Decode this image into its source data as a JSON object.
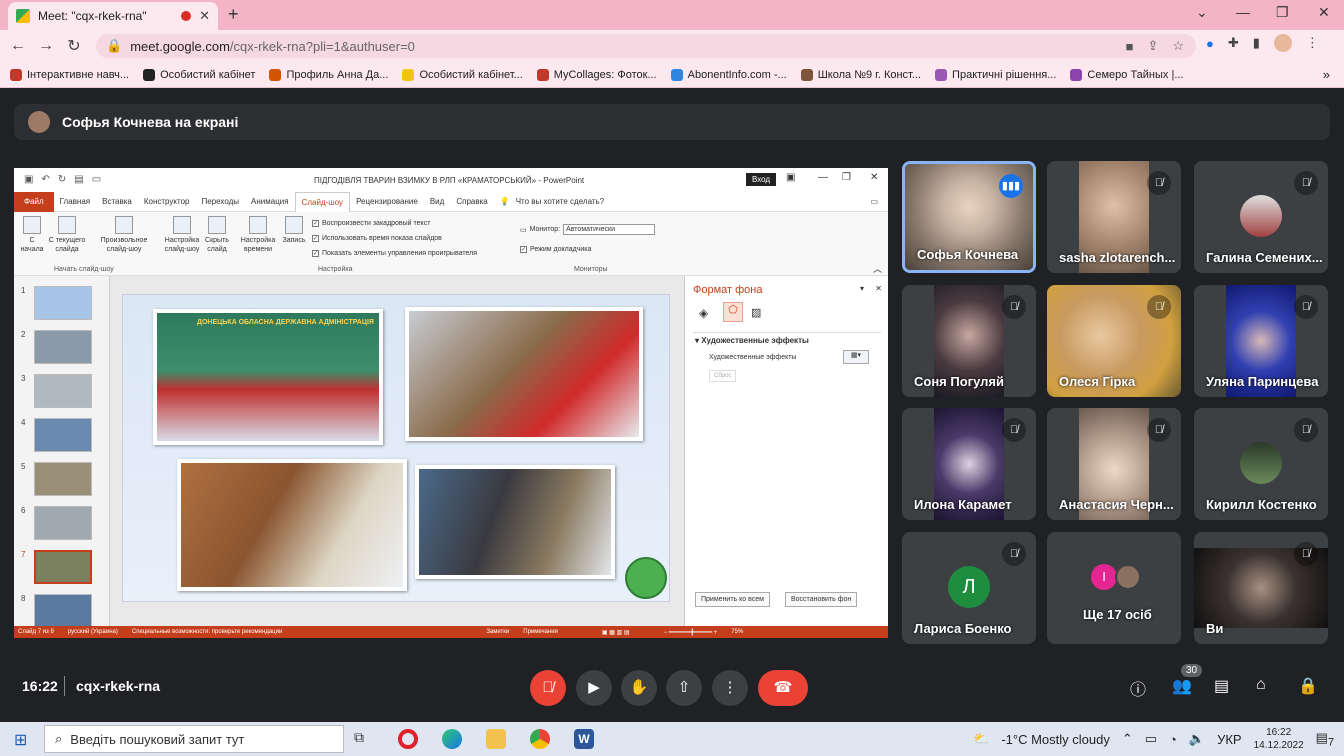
{
  "browser": {
    "tab_title": "Meet: \"cqx-rkek-rna\"",
    "url_domain": "meet.google.com",
    "url_path": "/cqx-rkek-rna?pli=1&authuser=0",
    "bookmarks": [
      "Інтерактивне навч...",
      "Особистий кабінет",
      "Профиль Анна Да...",
      "Особистий кабінет...",
      "MyCollages: Фоток...",
      "AbonentInfo.com -...",
      "Школа №9 г. Конст...",
      "Практичні рішення...",
      "Семеро Тайных |..."
    ],
    "bookmark_colors": [
      "#c0392b",
      "#222222",
      "#d35400",
      "#f1c40f",
      "#c0392b",
      "#2e86de",
      "#7f5539",
      "#9b59b6",
      "#8e44ad"
    ]
  },
  "presenter": {
    "label": "Софья Кочнева на екрані"
  },
  "powerpoint": {
    "title": "ПІДГОДІВЛЯ ТВАРИН ВЗИМКУ В РЛП «КРАМАТОРСЬКИЙ»  -  PowerPoint",
    "login": "Вход",
    "tabs": [
      "Файл",
      "Главная",
      "Вставка",
      "Конструктор",
      "Переходы",
      "Анимация",
      "Слайд-шоу",
      "Рецензирование",
      "Вид",
      "Справка"
    ],
    "tellme": "Что вы хотите сделать?",
    "ribbon": {
      "from_start": "С начала",
      "from_current": "С текущего слайда",
      "custom": "Произвольное слайд-шоу",
      "setup": "Настройка слайд-шоу",
      "hide": "Скрыть слайд",
      "timing": "Настройка времени",
      "record": "Запись",
      "chk1": "Воспроизвести закадровый текст",
      "chk2": "Использовать время показа слайдов",
      "chk3": "Показать элементы управления проигрывателя",
      "monitor_label": "Монитор:",
      "monitor_value": "Автоматически",
      "presenter_mode": "Режим докладчика",
      "group1": "Начать слайд-шоу",
      "group2": "Настройка",
      "group3": "Мониторы"
    },
    "slide_numbers": [
      "1",
      "2",
      "3",
      "4",
      "5",
      "6",
      "7",
      "8"
    ],
    "format_panel": {
      "title": "Формат фона",
      "section": "Художественные эффекты",
      "row": "Художественные эффекты",
      "reset": "Сброс",
      "apply_all": "Применить ко всем",
      "restore": "Восстановить фон"
    },
    "status": {
      "slide": "Слайд 7 из 8",
      "lang": "русский (Украина)",
      "access": "Специальные возможности: проверьте рекомендации",
      "notes": "Заметки",
      "comments": "Примечания",
      "zoom": "75%"
    },
    "slide_banner": "ДОНЕЦЬКА ОБЛАСНА ДЕРЖАВНА АДМІНІСТРАЦІЯ"
  },
  "participants": [
    {
      "name": "Софья Кочнева",
      "color": "#b8a89a"
    },
    {
      "name": "sasha zlotarench...",
      "color": "#c7a68e"
    },
    {
      "name": "Галина Семених...",
      "color": "#3c4043"
    },
    {
      "name": "Соня Погуляй",
      "color": "#2b2a2e"
    },
    {
      "name": "Олеся Гірка",
      "color": "#c8a050"
    },
    {
      "name": "Уляна Паринцева",
      "color": "#1a2a8a"
    },
    {
      "name": "Илона Карамет",
      "color": "#2a2440"
    },
    {
      "name": "Анастасия Черн...",
      "color": "#a49080"
    },
    {
      "name": "Кирилл Костенко",
      "color": "#3c4043"
    },
    {
      "name": "Лариса Боенко",
      "initial": "Л",
      "color": "#3c4043"
    },
    {
      "name": "Ще 17 осіб",
      "initial": "І",
      "color": "#3c4043"
    },
    {
      "name": "Ви",
      "color": "#2a2a2a"
    }
  ],
  "meetbar": {
    "time": "16:22",
    "code": "cqx-rkek-rna",
    "people_count": "30"
  },
  "taskbar": {
    "search": "Введіть пошуковий запит тут",
    "weather": "-1°C  Mostly cloudy",
    "lang": "УКР",
    "time": "16:22",
    "date": "14.12.2022",
    "notif": "7"
  }
}
